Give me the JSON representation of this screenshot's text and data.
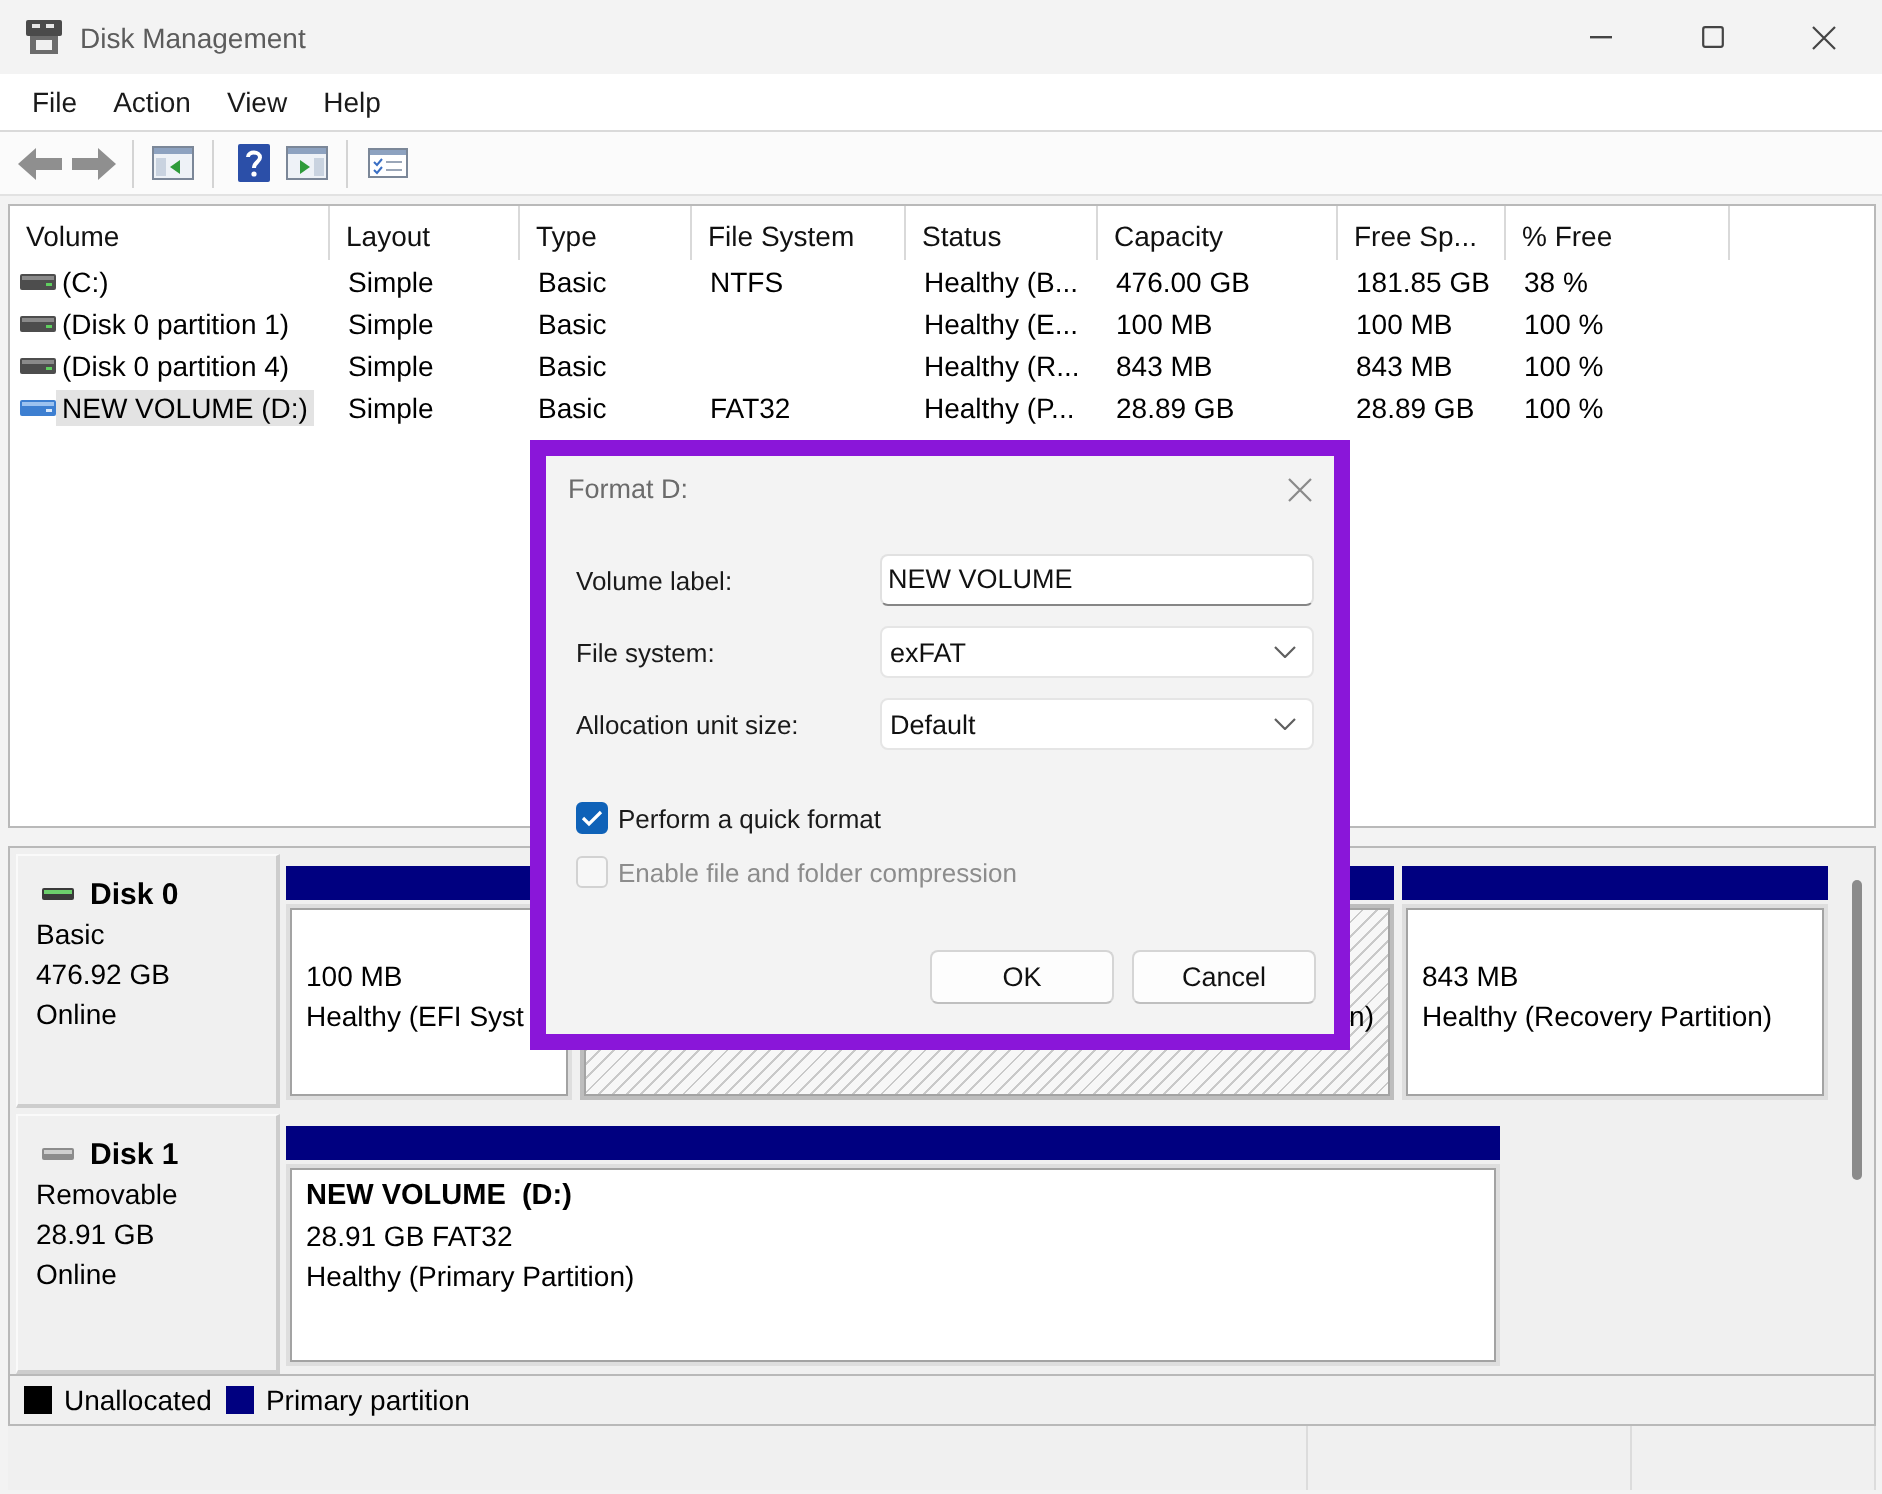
{
  "window": {
    "title": "Disk Management"
  },
  "menu": [
    {
      "label": "File"
    },
    {
      "label": "Action"
    },
    {
      "label": "View"
    },
    {
      "label": "Help"
    }
  ],
  "volume_table": {
    "columns": [
      "Volume",
      "Layout",
      "Type",
      "File System",
      "Status",
      "Capacity",
      "Free Sp...",
      "% Free"
    ],
    "rows": [
      {
        "kind": "fixed",
        "selected": false,
        "volume": "(C:)",
        "layout": "Simple",
        "type": "Basic",
        "file_system": "NTFS",
        "status": "Healthy (B...",
        "capacity": "476.00 GB",
        "free_space": "181.85 GB",
        "percent_free": "38 %"
      },
      {
        "kind": "fixed",
        "selected": false,
        "volume": "(Disk 0 partition 1)",
        "layout": "Simple",
        "type": "Basic",
        "status": "Healthy (E...",
        "capacity": "100 MB",
        "free_space": "100 MB",
        "percent_free": "100 %"
      },
      {
        "kind": "fixed",
        "selected": false,
        "volume": "(Disk 0 partition 4)",
        "layout": "Simple",
        "type": "Basic",
        "status": "Healthy (R...",
        "capacity": "843 MB",
        "free_space": "843 MB",
        "percent_free": "100 %"
      },
      {
        "kind": "removable",
        "selected": true,
        "volume": "NEW VOLUME (D:)",
        "layout": "Simple",
        "type": "Basic",
        "file_system": "FAT32",
        "status": "Healthy (P...",
        "capacity": "28.89 GB",
        "free_space": "28.89 GB",
        "percent_free": "100 %"
      }
    ]
  },
  "disks": [
    {
      "kind": "fixed",
      "name": "Disk 0",
      "details": [
        "Basic",
        "476.92 GB",
        "Online"
      ],
      "partitions": [
        {
          "kind": "primary",
          "selected": false,
          "size": "100 MB",
          "status": "Healthy (EFI Syst"
        },
        {
          "kind": "primary",
          "selected": true,
          "covered_left": true,
          "status": "n)"
        },
        {
          "kind": "primary",
          "selected": false,
          "size": "843 MB",
          "status": "Healthy (Recovery Partition)"
        }
      ]
    },
    {
      "kind": "removable",
      "name": "Disk 1",
      "details": [
        "Removable",
        "28.91 GB",
        "Online"
      ],
      "partitions": [
        {
          "kind": "primary",
          "selected": false,
          "name": "NEW VOLUME  (D:)",
          "size": "28.91 GB FAT32",
          "status": "Healthy (Primary Partition)"
        }
      ]
    }
  ],
  "legend": [
    {
      "label": "Unallocated",
      "color": "#000000"
    },
    {
      "label": "Primary partition",
      "color": "#000080"
    }
  ],
  "dialog": {
    "title": "Format D:",
    "fields": [
      {
        "kind": "text",
        "label": "Volume label:",
        "value": "NEW VOLUME"
      },
      {
        "kind": "select",
        "label": "File system:",
        "value": "exFAT"
      },
      {
        "kind": "select",
        "label": "Allocation unit size:",
        "value": "Default"
      }
    ],
    "options": [
      {
        "label": "Perform a quick format",
        "checked": true,
        "disabled": false
      },
      {
        "label": "Enable file and folder compression",
        "checked": false,
        "disabled": true
      }
    ],
    "buttons": [
      {
        "label": "OK"
      },
      {
        "label": "Cancel"
      }
    ]
  }
}
